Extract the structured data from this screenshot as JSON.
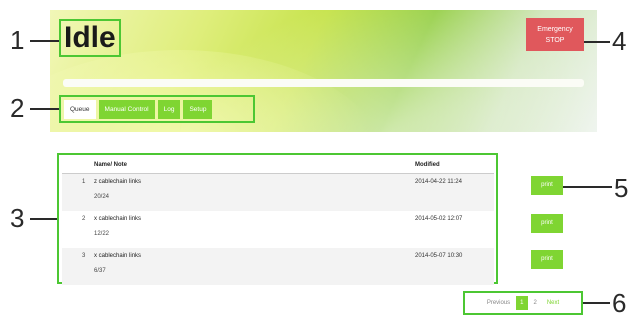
{
  "status": {
    "title": "Idle"
  },
  "emergency": {
    "label_line1": "Emergency",
    "label_line2": "STOP"
  },
  "tabs": [
    {
      "label": "Queue",
      "active": true
    },
    {
      "label": "Manual Control",
      "active": false
    },
    {
      "label": "Log",
      "active": false
    },
    {
      "label": "Setup",
      "active": false
    }
  ],
  "table": {
    "headers": {
      "name": "Name/ Note",
      "modified": "Modified"
    },
    "rows": [
      {
        "num": "1",
        "name": "z cablechain links",
        "note": "20/24",
        "modified": "2014-04-22 11:24",
        "action": "print"
      },
      {
        "num": "2",
        "name": "x cablechain links",
        "note": "12/22",
        "modified": "2014-05-02 12:07",
        "action": "print"
      },
      {
        "num": "3",
        "name": "x cablechain links",
        "note": "6/37",
        "modified": "2014-05-07 10:30",
        "action": "print"
      }
    ]
  },
  "pagination": {
    "previous": "Previous",
    "page1": "1",
    "page2": "2",
    "next": "Next"
  },
  "callouts": {
    "c1": "1",
    "c2": "2",
    "c3": "3",
    "c4": "4",
    "c5": "5",
    "c6": "6"
  },
  "colors": {
    "accent": "#7fd532",
    "annotation": "#4cc733",
    "danger": "#e0585c"
  }
}
